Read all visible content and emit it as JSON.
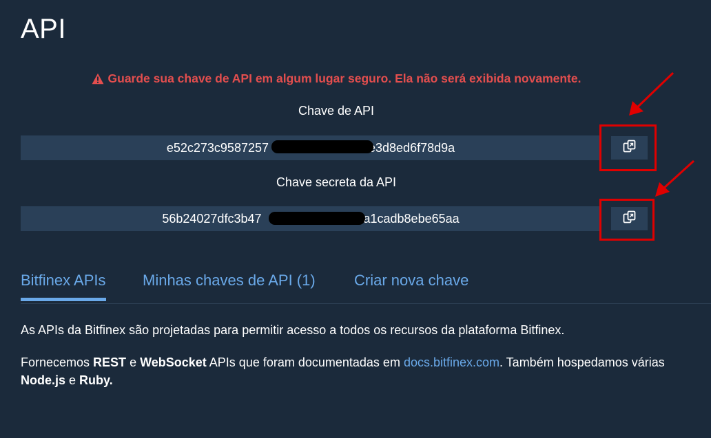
{
  "page": {
    "title": "API"
  },
  "warning": {
    "text": "Guarde sua chave de API em algum lugar seguro. Ela não será exibida novamente."
  },
  "api_key": {
    "label": "Chave de API",
    "prefix": "e52c273c9587257",
    "suffix": "e3d8ed6f78d9a"
  },
  "secret_key": {
    "label": "Chave secreta da API",
    "prefix": "56b24027dfc3b47",
    "suffix": "9a1cadb8ebe65aa"
  },
  "tabs": [
    {
      "label": "Bitfinex APIs"
    },
    {
      "label": "Minhas chaves de API (1)"
    },
    {
      "label": "Criar nova chave"
    }
  ],
  "content": {
    "para1": "As APIs da Bitfinex são projetadas para permitir acesso a todos os recursos da plataforma Bitfinex.",
    "para2": {
      "t1": "Fornecemos ",
      "b1": "REST",
      "t2": " e ",
      "b2": "WebSocket",
      "t3": " APIs que foram documentadas em ",
      "link": "docs.bitfinex.com",
      "t4": ". Também hospedamos várias",
      "b3": "Node.js",
      "t5": " e ",
      "b4": "Ruby."
    }
  },
  "colors": {
    "background": "#1b2a3b",
    "field": "#2a4058",
    "accent": "#6aa9e9",
    "warning": "#e34e4e",
    "annotation": "#e00000"
  },
  "icons": {
    "warning": "warning-triangle-icon",
    "copy": "copy-icon"
  }
}
